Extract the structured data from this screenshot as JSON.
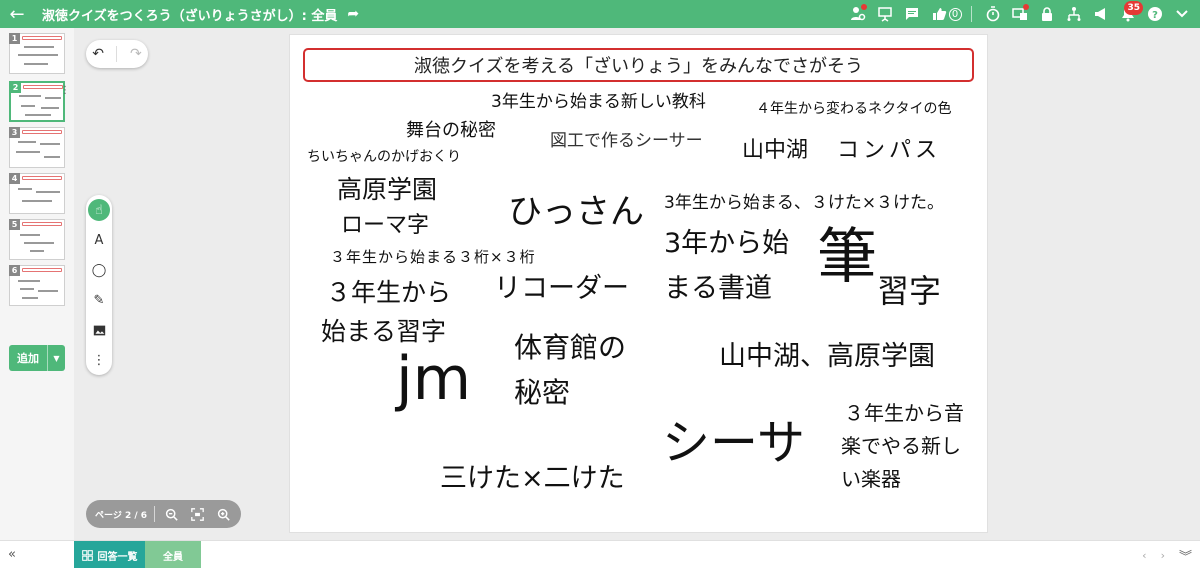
{
  "topbar": {
    "title": "淑徳クイズをつくろう（ざいりょうさがし）: 全員",
    "count_zero": "0",
    "notifications": "35"
  },
  "thumbnails": [
    {
      "num": "1"
    },
    {
      "num": "2"
    },
    {
      "num": "3"
    },
    {
      "num": "4"
    },
    {
      "num": "5"
    },
    {
      "num": "6"
    }
  ],
  "sidebar": {
    "add_label": "追加"
  },
  "pagenav": {
    "label": "ページ 2 / 6"
  },
  "canvas": {
    "header": "淑徳クイズを考える「ざいりょう」をみんなでさがそう",
    "words": [
      "3年生から始まる新しい教科",
      "４年生から変わるネクタイの色",
      "舞台の秘密",
      "図工で作るシーサー",
      "山中湖",
      "コンパス",
      "ちいちゃんのかげおくり",
      "高原学園",
      "ひっさん",
      "3年生から始まる、３けた×３けた。",
      "ローマ字",
      "３年生から始まる３桁×３桁",
      "3年から始",
      "まる書道",
      "筆",
      "習字",
      "３年生から",
      "始まる習字",
      "リコーダー",
      "体育館の",
      "秘密",
      "山中湖、高原学園",
      "jm",
      "３年生から音",
      "楽でやる新し",
      "い楽器",
      "シーサ",
      "三けた×二けた"
    ]
  },
  "bottombar": {
    "list_tab": "回答一覧",
    "all_tab": "全員"
  }
}
